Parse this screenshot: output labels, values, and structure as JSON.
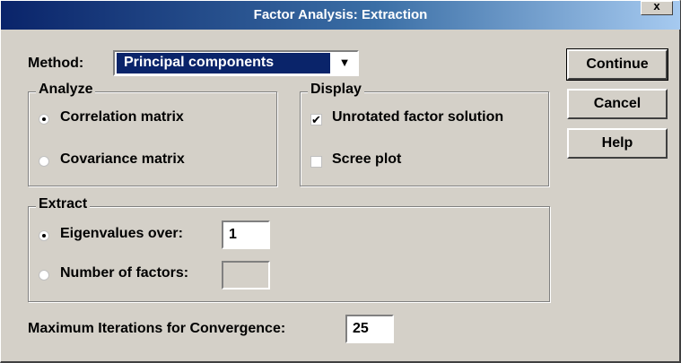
{
  "window": {
    "title": "Factor Analysis: Extraction",
    "close_label": "x"
  },
  "method": {
    "label": "Method:",
    "selected": "Principal components",
    "arrow": "▼"
  },
  "analyze": {
    "legend": "Analyze",
    "options": [
      {
        "label": "Correlation matrix",
        "selected": true
      },
      {
        "label": "Covariance matrix",
        "selected": false
      }
    ]
  },
  "display": {
    "legend": "Display",
    "options": [
      {
        "label": "Unrotated factor solution",
        "checked": true,
        "mark": "✔"
      },
      {
        "label": "Scree plot",
        "checked": false,
        "mark": ""
      }
    ]
  },
  "extract": {
    "legend": "Extract",
    "eigen": {
      "label": "Eigenvalues over:",
      "value": "1",
      "selected": true
    },
    "factors": {
      "label": "Number of factors:",
      "value": "",
      "selected": false
    }
  },
  "iterations": {
    "label": "Maximum Iterations for Convergence:",
    "value": "25"
  },
  "buttons": {
    "continue": "Continue",
    "cancel": "Cancel",
    "help": "Help"
  }
}
